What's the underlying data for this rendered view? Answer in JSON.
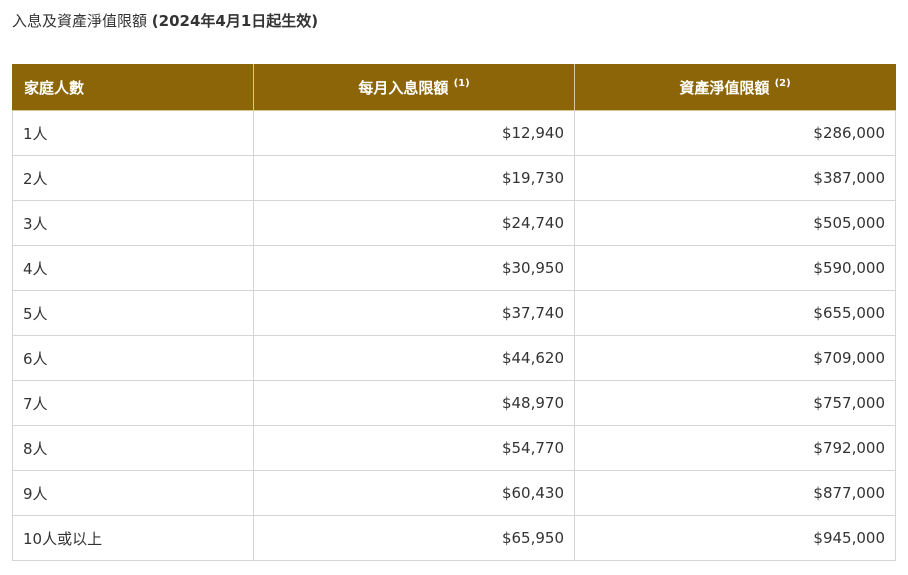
{
  "title": {
    "main": "入息及資產淨值限額 ",
    "date": "(2024年4月1日起生效)"
  },
  "colors": {
    "header_bg": "#8b6508",
    "header_text": "#ffffff",
    "border": "#d4d4d4"
  },
  "table": {
    "headers": {
      "household": "家庭人數",
      "income": "每月入息限額 ",
      "income_note": "(1)",
      "assets": "資產淨值限額 ",
      "assets_note": "(2)"
    },
    "rows": [
      {
        "household": "1人",
        "income": "$12,940",
        "assets": "$286,000"
      },
      {
        "household": "2人",
        "income": "$19,730",
        "assets": "$387,000"
      },
      {
        "household": "3人",
        "income": "$24,740",
        "assets": "$505,000"
      },
      {
        "household": "4人",
        "income": "$30,950",
        "assets": "$590,000"
      },
      {
        "household": "5人",
        "income": "$37,740",
        "assets": "$655,000"
      },
      {
        "household": "6人",
        "income": "$44,620",
        "assets": "$709,000"
      },
      {
        "household": "7人",
        "income": "$48,970",
        "assets": "$757,000"
      },
      {
        "household": "8人",
        "income": "$54,770",
        "assets": "$792,000"
      },
      {
        "household": "9人",
        "income": "$60,430",
        "assets": "$877,000"
      },
      {
        "household": "10人或以上",
        "income": "$65,950",
        "assets": "$945,000"
      }
    ]
  }
}
